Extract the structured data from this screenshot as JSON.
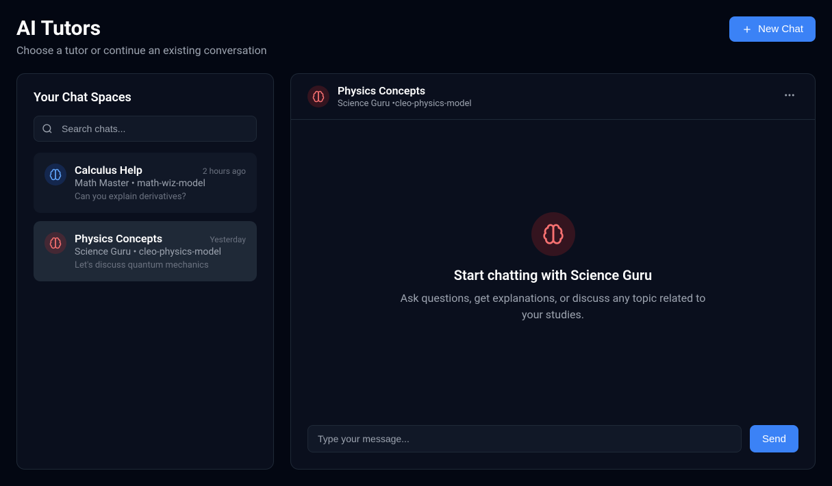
{
  "header": {
    "title": "AI Tutors",
    "subtitle": "Choose a tutor or continue an existing conversation",
    "new_chat_label": "New Chat"
  },
  "sidebar": {
    "title": "Your Chat Spaces",
    "search_placeholder": "Search chats...",
    "items": [
      {
        "title": "Calculus Help",
        "time": "2 hours ago",
        "tutor": "Math Master",
        "model": "math-wiz-model",
        "preview": "Can you explain derivatives?",
        "avatar_color": "blue",
        "selected": false
      },
      {
        "title": "Physics Concepts",
        "time": "Yesterday",
        "tutor": "Science Guru",
        "model": "cleo-physics-model",
        "preview": "Let's discuss quantum mechanics",
        "avatar_color": "red",
        "selected": true
      }
    ]
  },
  "main": {
    "title": "Physics Concepts",
    "tutor": "Science Guru",
    "model": "cleo-physics-model",
    "subtitle_sep": " •",
    "empty_heading_prefix": "Start chatting with ",
    "empty_heading": "Start chatting with Science Guru",
    "empty_desc": "Ask questions, get explanations, or discuss any topic related to your studies.",
    "input_placeholder": "Type your message...",
    "send_label": "Send",
    "avatar_color": "red"
  }
}
